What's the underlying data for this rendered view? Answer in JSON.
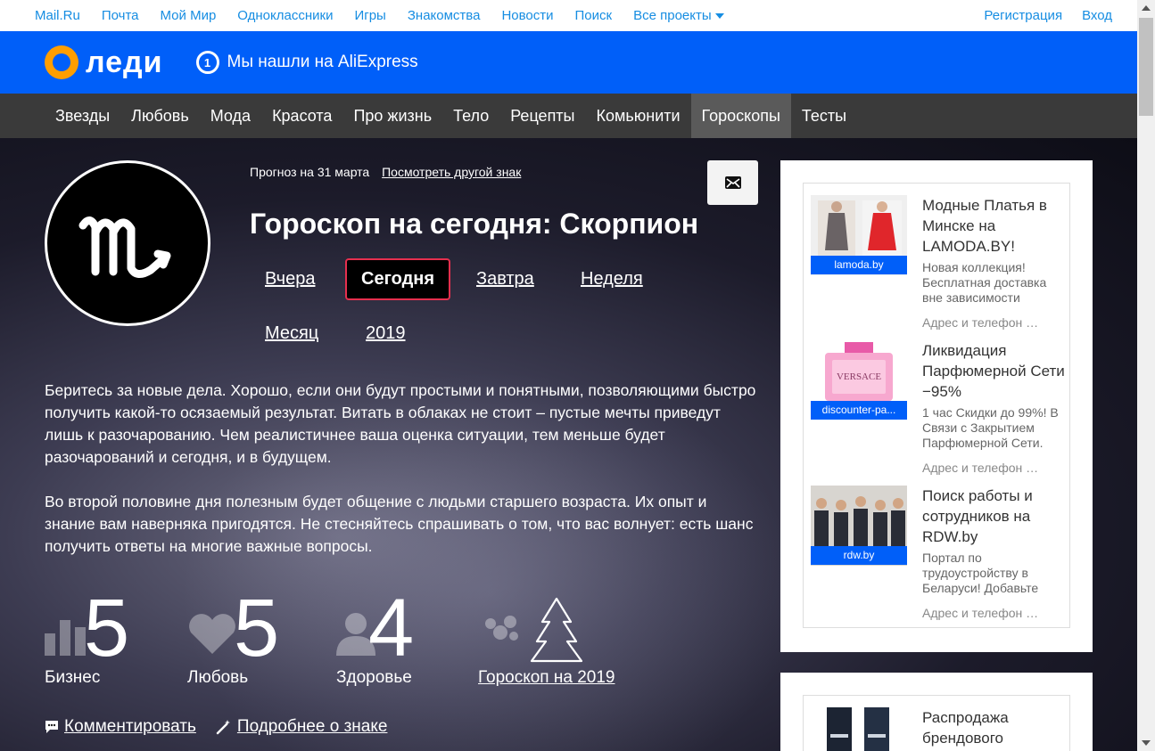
{
  "portal": {
    "links": [
      "Mail.Ru",
      "Почта",
      "Мой Мир",
      "Одноклассники",
      "Игры",
      "Знакомства",
      "Новости",
      "Поиск",
      "Все проекты"
    ],
    "register": "Регистрация",
    "login": "Вход"
  },
  "header": {
    "logo_text": "леди",
    "ali_badge": "1",
    "ali_text": "Мы нашли на AliExpress"
  },
  "nav": {
    "items": [
      "Звезды",
      "Любовь",
      "Мода",
      "Красота",
      "Про жизнь",
      "Тело",
      "Рецепты",
      "Комьюнити",
      "Гороскопы",
      "Тесты"
    ],
    "active": "Гороскопы"
  },
  "horoscope": {
    "forecast_date": "Прогноз на 31 марта",
    "other_sign": "Посмотреть другой знак",
    "title": "Гороскоп на сегодня: Скорпион",
    "tabs": [
      "Вчера",
      "Сегодня",
      "Завтра",
      "Неделя",
      "Месяц",
      "2019"
    ],
    "active_tab": "Сегодня",
    "paragraph1": "Беритесь за новые дела. Хорошо, если они будут простыми и понятными, позволяющими быстро получить какой-то осязаемый результат. Витать в облаках не стоит – пустые мечты приведут лишь к разочарованию. Чем реалистичнее ваша оценка ситуации, тем меньше будет разочарований и сегодня, и в будущем.",
    "paragraph2": "Во второй половине дня полезным будет общение с людьми старшего возраста. Их опыт и знание вам наверняка пригодятся. Не стесняйтесь спрашивать о том, что вас волнует: есть шанс получить ответы на многие важные вопросы.",
    "stats": [
      {
        "value": "5",
        "label": "Бизнес"
      },
      {
        "value": "5",
        "label": "Любовь"
      },
      {
        "value": "4",
        "label": "Здоровье"
      }
    ],
    "horoscope_2019": "Гороскоп на 2019",
    "comment": "Комментировать",
    "more_about_sign": "Подробнее о знаке"
  },
  "ads": [
    {
      "title": "Модные Платья в Минске на LAMODA.BY!",
      "desc": "Новая коллекция! Бесплатная доставка вне зависимости",
      "source": "lamoda.by",
      "address": "Адрес и телефон"
    },
    {
      "title": "Ликвидация Парфюмерной Сети −95%",
      "desc": "1 час Скидки до 99%! В Связи с Закрытием Парфюмерной Сети.",
      "source": "discounter-pa...",
      "address": "Адрес и телефон",
      "brand": "VERSACE"
    },
    {
      "title": "Поиск работы и сотрудников на RDW.by",
      "desc": "Портал по трудоустройству в Беларуси! Добавьте",
      "source": "rdw.by",
      "address": "Адрес и телефон"
    },
    {
      "title": "Распродажа брендового"
    }
  ],
  "colors": {
    "brand_blue": "#005ff9",
    "accent_orange": "#ff9e00",
    "active_tab_border": "#e62f4e",
    "nav_bg": "#3a3a3a"
  }
}
